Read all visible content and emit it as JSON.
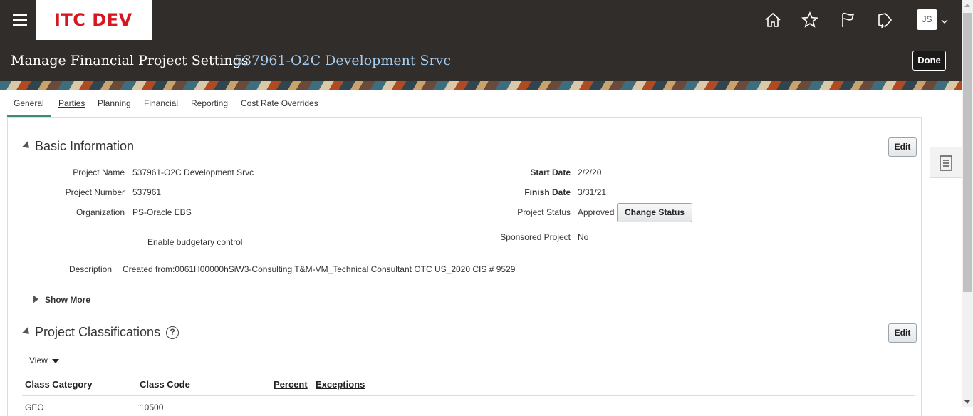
{
  "header": {
    "brand": "ITC DEV",
    "icons": [
      "hamburger-icon",
      "home-icon",
      "star-icon",
      "flag-icon",
      "notification-icon",
      "chevron-down-icon"
    ],
    "user_initials": "JS"
  },
  "page": {
    "title": "Manage Financial Project Settings",
    "subtitle": "537961-O2C Development Srvc",
    "done_label": "Done"
  },
  "tabs": [
    {
      "label": "General",
      "active": true
    },
    {
      "label": "Parties",
      "active": false
    },
    {
      "label": "Planning",
      "active": false
    },
    {
      "label": "Financial",
      "active": false
    },
    {
      "label": "Reporting",
      "active": false
    },
    {
      "label": "Cost Rate Overrides",
      "active": false
    }
  ],
  "basic_info": {
    "title": "Basic Information",
    "edit_label": "Edit",
    "project_name_label": "Project Name",
    "project_name": "537961-O2C Development Srvc",
    "project_number_label": "Project Number",
    "project_number": "537961",
    "organization_label": "Organization",
    "organization": "PS-Oracle EBS",
    "budgetary_control_label": "Enable budgetary control",
    "start_date_label": "Start Date",
    "start_date": "2/2/20",
    "finish_date_label": "Finish Date",
    "finish_date": "3/31/21",
    "project_status_label": "Project Status",
    "project_status": "Approved",
    "change_status_label": "Change Status",
    "sponsored_label": "Sponsored Project",
    "sponsored": "No",
    "description_label": "Description",
    "description": "Created from:0061H00000hSiW3-Consulting T&M-VM_Technical Consultant OTC US_2020 CIS # 9529",
    "show_more_label": "Show More"
  },
  "classifications": {
    "title": "Project Classifications",
    "edit_label": "Edit",
    "view_label": "View",
    "columns": [
      "Class Category",
      "Class Code",
      "Percent",
      "Exceptions"
    ],
    "rows": [
      {
        "class_category": "GEO",
        "class_code": "10500"
      }
    ]
  },
  "colors": {
    "header_bg": "#312d2a",
    "brand_red": "#d7171f",
    "subtitle_blue": "#a6cdf0",
    "active_tab": "#3d8c7a"
  }
}
